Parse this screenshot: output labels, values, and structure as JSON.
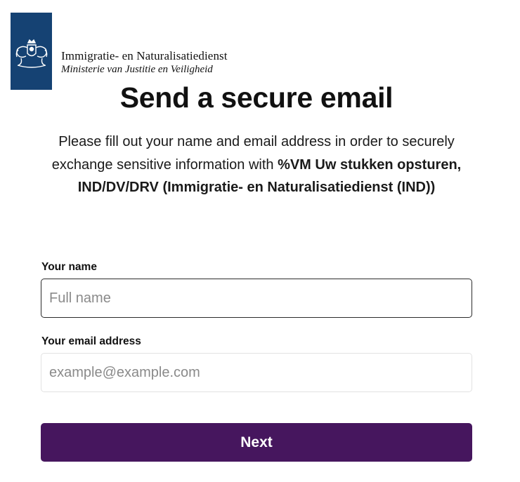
{
  "header": {
    "org_name": "Immigratie- en Naturalisatiedienst",
    "org_sub": "Ministerie van Justitie en Veiligheid",
    "logo_icon": "coat-of-arms-icon",
    "logo_color": "#154273"
  },
  "main": {
    "title": "Send a secure email",
    "intro_prefix": "Please fill out your name and email address in order to securely exchange sensitive information with ",
    "intro_recipient": "%VM Uw stukken opsturen, IND/DV/DRV (Immigratie- en Naturalisatiedienst (IND))"
  },
  "form": {
    "name_label": "Your name",
    "name_value": "",
    "name_placeholder": "Full name",
    "email_label": "Your email address",
    "email_value": "",
    "email_placeholder": "example@example.com",
    "next_label": "Next",
    "button_color": "#46165e"
  }
}
